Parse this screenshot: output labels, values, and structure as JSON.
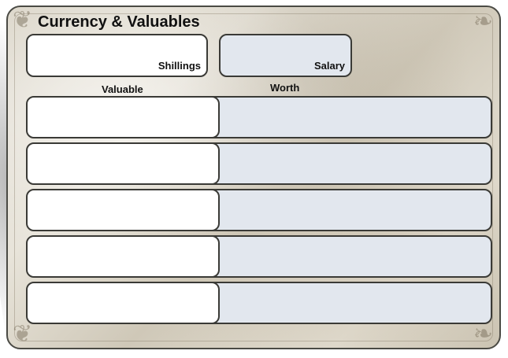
{
  "sheet": {
    "title": "Currency & Valuables",
    "shillings_label": "Shillings",
    "salary_label": "Salary",
    "shillings_value": "",
    "salary_value": ""
  },
  "table": {
    "headers": {
      "valuable": "Valuable",
      "worth": "Worth"
    },
    "rows": [
      {
        "valuable": "",
        "worth": ""
      },
      {
        "valuable": "",
        "worth": ""
      },
      {
        "valuable": "",
        "worth": ""
      },
      {
        "valuable": "",
        "worth": ""
      },
      {
        "valuable": "",
        "worth": ""
      }
    ]
  },
  "colors": {
    "paper": "#e4dfd3",
    "border": "#3a3a36",
    "field_white": "#ffffff",
    "field_blue": "#e2e7ee"
  },
  "icons": {
    "corner_ornament": "flourish-icon"
  }
}
